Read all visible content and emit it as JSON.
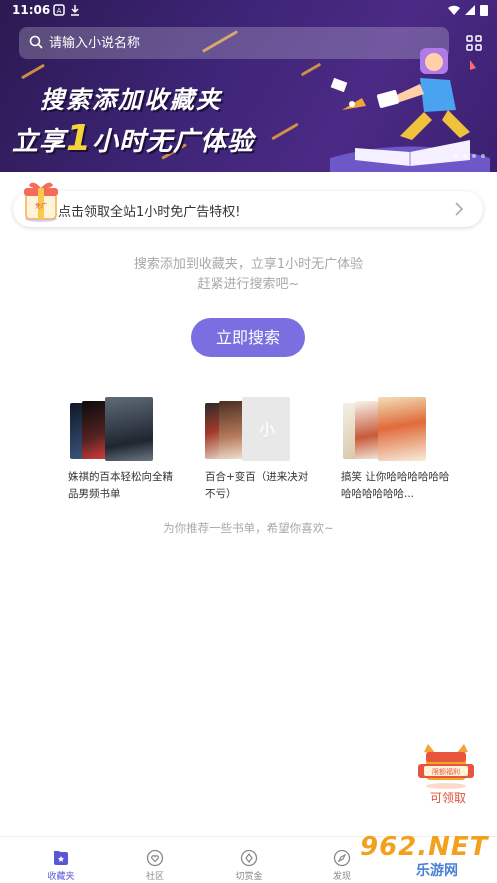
{
  "status_bar": {
    "time": "11:06"
  },
  "search": {
    "placeholder": "请输入小说名称"
  },
  "banner": {
    "line1": "搜索添加收藏夹",
    "line2_prefix": "立享",
    "line2_highlight": "1",
    "line2_suffix": "小时无广体验"
  },
  "promo": {
    "text": "点击领取全站1小时免广告特权!"
  },
  "empty_state": {
    "line1": "搜索添加到收藏夹，立享1小时无广体验",
    "line2": "赶紧进行搜索吧~",
    "button": "立即搜索"
  },
  "booklists": [
    {
      "title": "姝祺的百本轻松向全精品男频书单"
    },
    {
      "title": "百合+变百（进来决对不亏）"
    },
    {
      "title": "搞笑 让你哈哈哈哈哈哈哈哈哈哈哈哈..."
    }
  ],
  "recommend_text": "为你推荐一些书单，希望你喜欢~",
  "float_reward": {
    "label": "可领取"
  },
  "tabs": [
    {
      "label": "收藏夹",
      "icon": "bookmark-icon",
      "active": true
    },
    {
      "label": "社区",
      "icon": "community-icon",
      "active": false
    },
    {
      "label": "切赏金",
      "icon": "coin-icon",
      "active": false
    },
    {
      "label": "发现",
      "icon": "discover-icon",
      "active": false
    }
  ],
  "watermark": {
    "main": "962.NET",
    "sub": "乐游网"
  },
  "colors": {
    "accent": "#7b6ee0",
    "banner_bg": "#3d2475",
    "tab_active": "#5a57d6"
  }
}
